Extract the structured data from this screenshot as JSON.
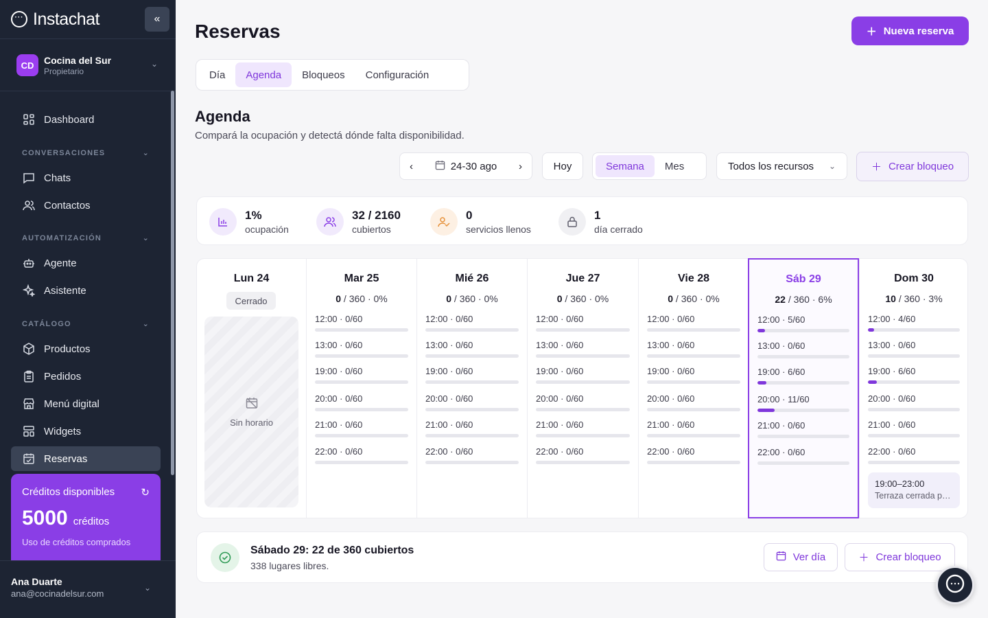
{
  "app": {
    "brand": "Instachat"
  },
  "org": {
    "initials": "CD",
    "name": "Cocina del Sur",
    "role": "Propietario"
  },
  "nav": {
    "dashboard": "Dashboard",
    "sec_conversaciones": "CONVERSACIONES",
    "chats": "Chats",
    "contactos": "Contactos",
    "sec_automatizacion": "AUTOMATIZACIÓN",
    "agente": "Agente",
    "asistente": "Asistente",
    "sec_catalogo": "CATÁLOGO",
    "productos": "Productos",
    "pedidos": "Pedidos",
    "menu": "Menú digital",
    "widgets": "Widgets",
    "reservas": "Reservas"
  },
  "credits": {
    "title": "Créditos disponibles",
    "amount": "5000",
    "unit": "créditos",
    "sub": "Uso de créditos comprados"
  },
  "user": {
    "name": "Ana Duarte",
    "email": "ana@cocinadelsur.com"
  },
  "page": {
    "title": "Reservas",
    "new_button": "Nueva reserva"
  },
  "tabs": [
    "Día",
    "Agenda",
    "Bloqueos",
    "Configuración"
  ],
  "agenda": {
    "title": "Agenda",
    "subtitle": "Compará la ocupación y detectá dónde falta disponibilidad."
  },
  "controls": {
    "range": "24-30 ago",
    "today": "Hoy",
    "week": "Semana",
    "month": "Mes",
    "resources": "Todos los recursos",
    "create_block": "Crear bloqueo"
  },
  "stats": [
    {
      "value": "1%",
      "label": "ocupación"
    },
    {
      "value": "32 / 2160",
      "label": "cubiertos"
    },
    {
      "value": "0",
      "label": "servicios llenos"
    },
    {
      "value": "1",
      "label": "día cerrado"
    }
  ],
  "days": [
    {
      "name": "Lun 24",
      "closed": true,
      "closed_label": "Cerrado",
      "no_schedule": "Sin horario"
    },
    {
      "name": "Mar 25",
      "booked": "0",
      "rest": " / 360 · 0%",
      "slots": [
        [
          "12:00 · 0/60",
          0
        ],
        [
          "13:00 · 0/60",
          0
        ],
        [
          "19:00 · 0/60",
          0
        ],
        [
          "20:00 · 0/60",
          0
        ],
        [
          "21:00 · 0/60",
          0
        ],
        [
          "22:00 · 0/60",
          0
        ]
      ]
    },
    {
      "name": "Mié 26",
      "booked": "0",
      "rest": " / 360 · 0%",
      "slots": [
        [
          "12:00 · 0/60",
          0
        ],
        [
          "13:00 · 0/60",
          0
        ],
        [
          "19:00 · 0/60",
          0
        ],
        [
          "20:00 · 0/60",
          0
        ],
        [
          "21:00 · 0/60",
          0
        ],
        [
          "22:00 · 0/60",
          0
        ]
      ]
    },
    {
      "name": "Jue 27",
      "booked": "0",
      "rest": " / 360 · 0%",
      "slots": [
        [
          "12:00 · 0/60",
          0
        ],
        [
          "13:00 · 0/60",
          0
        ],
        [
          "19:00 · 0/60",
          0
        ],
        [
          "20:00 · 0/60",
          0
        ],
        [
          "21:00 · 0/60",
          0
        ],
        [
          "22:00 · 0/60",
          0
        ]
      ]
    },
    {
      "name": "Vie 28",
      "booked": "0",
      "rest": " / 360 · 0%",
      "slots": [
        [
          "12:00 · 0/60",
          0
        ],
        [
          "13:00 · 0/60",
          0
        ],
        [
          "19:00 · 0/60",
          0
        ],
        [
          "20:00 · 0/60",
          0
        ],
        [
          "21:00 · 0/60",
          0
        ],
        [
          "22:00 · 0/60",
          0
        ]
      ]
    },
    {
      "name": "Sáb 29",
      "selected": true,
      "booked": "22",
      "rest": " / 360 · 6%",
      "slots": [
        [
          "12:00 · 5/60",
          0.0833
        ],
        [
          "13:00 · 0/60",
          0
        ],
        [
          "19:00 · 6/60",
          0.1
        ],
        [
          "20:00 · 11/60",
          0.1833
        ],
        [
          "21:00 · 0/60",
          0
        ],
        [
          "22:00 · 0/60",
          0
        ]
      ]
    },
    {
      "name": "Dom 30",
      "booked": "10",
      "rest": " / 360 · 3%",
      "slots": [
        [
          "12:00 · 4/60",
          0.0667
        ],
        [
          "13:00 · 0/60",
          0
        ],
        [
          "19:00 · 6/60",
          0.1
        ],
        [
          "20:00 · 0/60",
          0
        ],
        [
          "21:00 · 0/60",
          0
        ],
        [
          "22:00 · 0/60",
          0
        ]
      ],
      "block": {
        "time": "19:00–23:00",
        "label": "Terraza cerrada por evento"
      }
    }
  ],
  "summary": {
    "title": "Sábado 29: 22 de 360 cubiertos",
    "sub": "338 lugares libres.",
    "view_day": "Ver día",
    "create_block": "Crear bloqueo"
  },
  "colors": {
    "accent": "#8a3ee6",
    "sidebar": "#1d2433"
  }
}
